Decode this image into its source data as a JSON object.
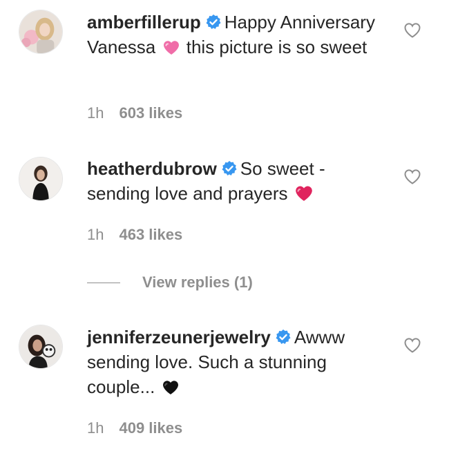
{
  "comments": [
    {
      "username": "amberfillerup",
      "text_parts": [
        "Happy Anniversary Vanessa",
        "this picture is so sweet"
      ],
      "emoji": "pink-heart-icon",
      "time": "1h",
      "likes": "603 likes"
    },
    {
      "username": "heatherdubrow",
      "text_parts": [
        "So sweet - sending love and prayers"
      ],
      "emoji": "red-heart-icon",
      "time": "1h",
      "likes": "463 likes"
    },
    {
      "username": "jenniferzeunerjewelry",
      "text_parts": [
        "Awww sending love. Such a stunning couple..."
      ],
      "emoji": "black-heart-icon",
      "time": "1h",
      "likes": "409 likes"
    }
  ],
  "view_replies": "View replies (1)",
  "colors": {
    "text": "#262626",
    "muted": "#8e8e8e",
    "verified": "#3897f0",
    "pink_heart": "#f06da8",
    "red_heart": "#e0245e",
    "black_heart": "#111111"
  }
}
